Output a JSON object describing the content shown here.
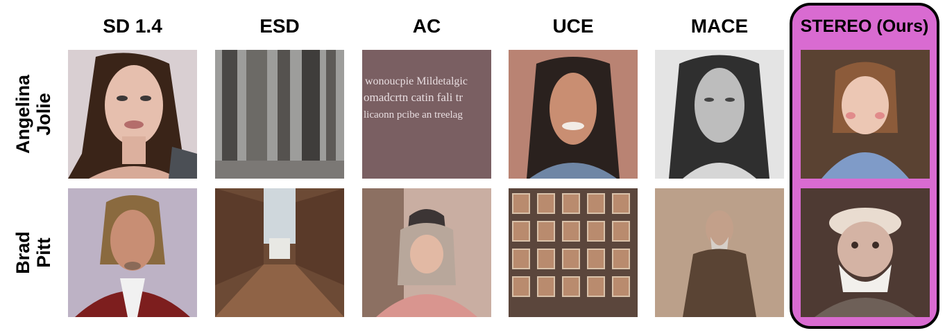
{
  "columns": [
    "SD 1.4",
    "ESD",
    "AC",
    "UCE",
    "MACE",
    "STEREO (Ours)"
  ],
  "rows": [
    {
      "label_line1": "Angelina",
      "label_line2": "Jolie"
    },
    {
      "label_line1": "Brad",
      "label_line2": "Pitt"
    }
  ],
  "highlight": {
    "column": "STEREO (Ours)",
    "panel_color": "#d96bd1",
    "border_color": "#000000"
  },
  "ac_tile_text": [
    "wonoucpie Mildetalgic",
    "omadcrtn catin fali tr",
    "licaonn pcibe an treelag"
  ]
}
